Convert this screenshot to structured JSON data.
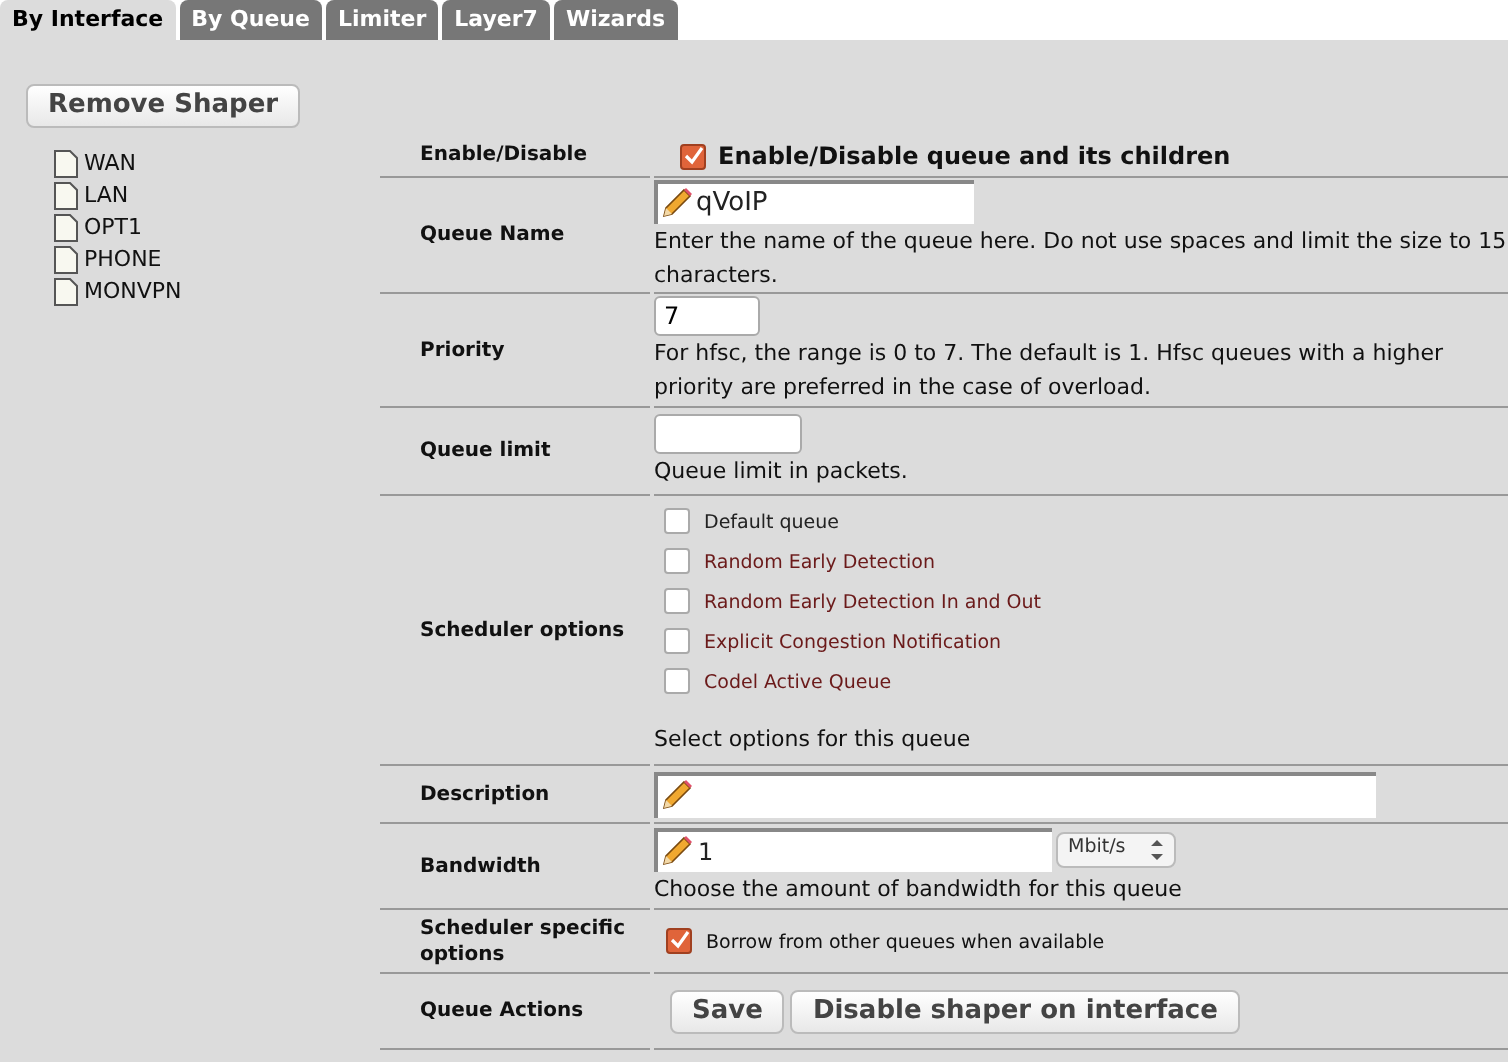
{
  "tabs": [
    {
      "label": "By Interface",
      "selected": true
    },
    {
      "label": "By Queue",
      "selected": false
    },
    {
      "label": "Limiter",
      "selected": false
    },
    {
      "label": "Layer7",
      "selected": false
    },
    {
      "label": "Wizards",
      "selected": false
    }
  ],
  "remove_button": "Remove Shaper",
  "interfaces": [
    {
      "label": "WAN"
    },
    {
      "label": "LAN"
    },
    {
      "label": "OPT1"
    },
    {
      "label": "PHONE"
    },
    {
      "label": "MONVPN"
    }
  ],
  "form": {
    "enable": {
      "label": "Enable/Disable",
      "checked": true,
      "text": "Enable/Disable queue and its children"
    },
    "queue_name": {
      "label": "Queue Name",
      "value": "qVoIP",
      "help": "Enter the name of the queue here. Do not use spaces and limit the size to 15 characters."
    },
    "priority": {
      "label": "Priority",
      "value": "7",
      "help": "For hfsc, the range is 0 to 7. The default is 1. Hfsc queues with a higher priority are preferred in the case of overload."
    },
    "queue_limit": {
      "label": "Queue limit",
      "help": "Queue limit in packets."
    },
    "scheduler_options": {
      "label": "Scheduler options",
      "options": [
        {
          "label": "Default queue",
          "checked": false,
          "color": "#222222"
        },
        {
          "label": "Random Early Detection",
          "checked": false,
          "color": "#6b1a1a"
        },
        {
          "label": "Random Early Detection In and Out",
          "checked": false,
          "color": "#6b1a1a"
        },
        {
          "label": "Explicit Congestion Notification",
          "checked": false,
          "color": "#6b1a1a"
        },
        {
          "label": "Codel Active Queue",
          "checked": false,
          "color": "#6b1a1a"
        }
      ],
      "help": "Select options for this queue"
    },
    "description": {
      "label": "Description"
    },
    "bandwidth": {
      "label": "Bandwidth",
      "value": "1",
      "unit": "Mbit/s",
      "help": "Choose the amount of bandwidth for this queue"
    },
    "scheduler_specific": {
      "label": "Scheduler specific options",
      "checked": true,
      "text": "Borrow from other queues when available"
    },
    "actions": {
      "label": "Queue Actions",
      "buttons": [
        "Save",
        "Disable shaper on interface"
      ]
    }
  }
}
